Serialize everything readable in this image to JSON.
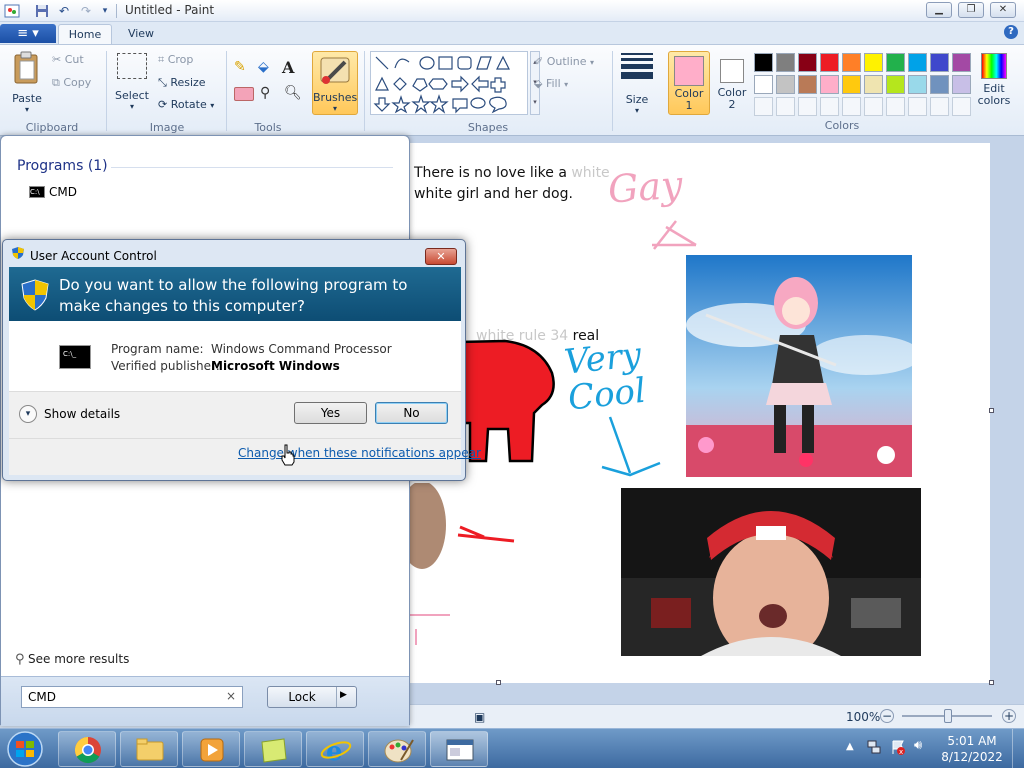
{
  "window": {
    "title": "Untitled - Paint"
  },
  "ribbon": {
    "tabs": {
      "file": "≡ ▾",
      "home": "Home",
      "view": "View"
    },
    "clipboard": {
      "label": "Clipboard",
      "paste": "Paste",
      "cut": "Cut",
      "copy": "Copy"
    },
    "image": {
      "label": "Image",
      "select": "Select",
      "crop": "Crop",
      "resize": "Resize",
      "rotate": "Rotate"
    },
    "tools": {
      "label": "Tools"
    },
    "brushes": {
      "label": "Brushes"
    },
    "shapes": {
      "label": "Shapes",
      "outline": "Outline",
      "fill": "Fill"
    },
    "size": {
      "label": "Size"
    },
    "color1": {
      "label": "Color\n1",
      "color": "#ffaec9"
    },
    "color2": {
      "label": "Color\n2",
      "color": "#ffffff"
    },
    "colors": {
      "label": "Colors",
      "row1": [
        "#000000",
        "#7f7f7f",
        "#880015",
        "#ed1c24",
        "#ff7f27",
        "#fff200",
        "#22b14c",
        "#00a2e8",
        "#3f48cc",
        "#a349a4"
      ],
      "row2": [
        "#ffffff",
        "#c3c3c3",
        "#b97a57",
        "#ffaec9",
        "#ffc90e",
        "#efe4b0",
        "#b5e61d",
        "#99d9ea",
        "#7092be",
        "#c8bfe7"
      ]
    },
    "edit_colors": "Edit\ncolors"
  },
  "canvas": {
    "text1_line1": "There is no love like a",
    "text1_faded1": "white",
    "text1_line2": "white girl and her dog.",
    "text2_faded": "white rule 34",
    "text2": "real",
    "scribble_gay": "Gay",
    "scribble_very_cool": "Very Cool"
  },
  "statusbar": {
    "zoom": "100%"
  },
  "start_menu": {
    "programs_header": "Programs (1)",
    "program": "CMD",
    "see_more": "See more results",
    "search_value": "CMD",
    "lock_button": "Lock"
  },
  "uac": {
    "title": "User Account Control",
    "question": "Do you want to allow the following program to make changes to this computer?",
    "program_name_label": "Program name:",
    "program_name_value": "Windows Command Processor",
    "publisher_label": "Verified publisher:",
    "publisher_value": "Microsoft Windows",
    "show_details": "Show details",
    "yes": "Yes",
    "no": "No",
    "change_link": "Change when these notifications appear"
  },
  "taskbar": {
    "time": "5:01 AM",
    "date": "8/12/2022"
  }
}
